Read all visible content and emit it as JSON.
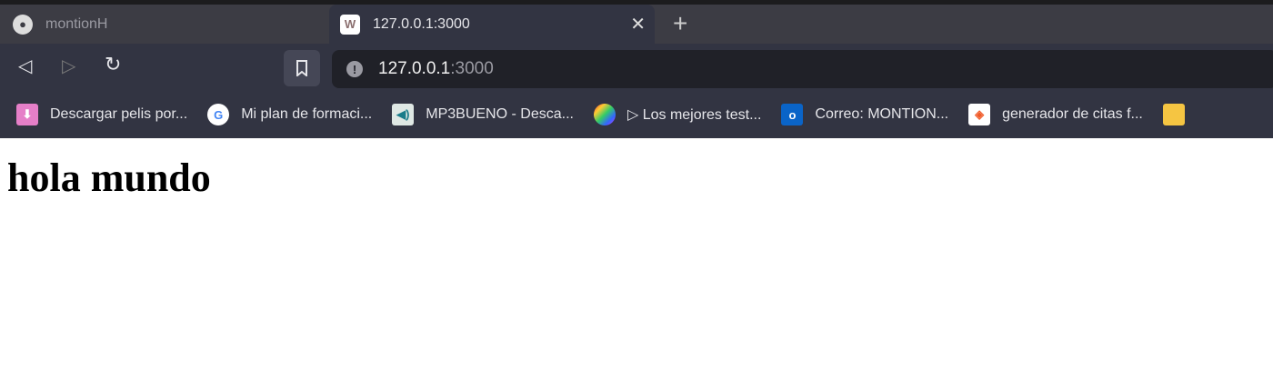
{
  "tabs": [
    {
      "title": "montionH",
      "icon": "github-icon"
    },
    {
      "title": "127.0.0.1:3000",
      "icon": "w-icon",
      "active": true
    }
  ],
  "address": {
    "host": "127.0.0.1",
    "port": ":3000"
  },
  "bookmarks": [
    {
      "label": "Descargar pelis por...",
      "icon": "download-icon"
    },
    {
      "label": "Mi plan de formaci...",
      "icon": "google-icon"
    },
    {
      "label": "MP3BUENO - Desca...",
      "icon": "speaker-icon"
    },
    {
      "label": "▷ Los mejores test...",
      "icon": "brain-icon"
    },
    {
      "label": "Correo: MONTION...",
      "icon": "outlook-icon"
    },
    {
      "label": "generador de citas f...",
      "icon": "cap-icon"
    }
  ],
  "page": {
    "heading": "hola mundo"
  }
}
